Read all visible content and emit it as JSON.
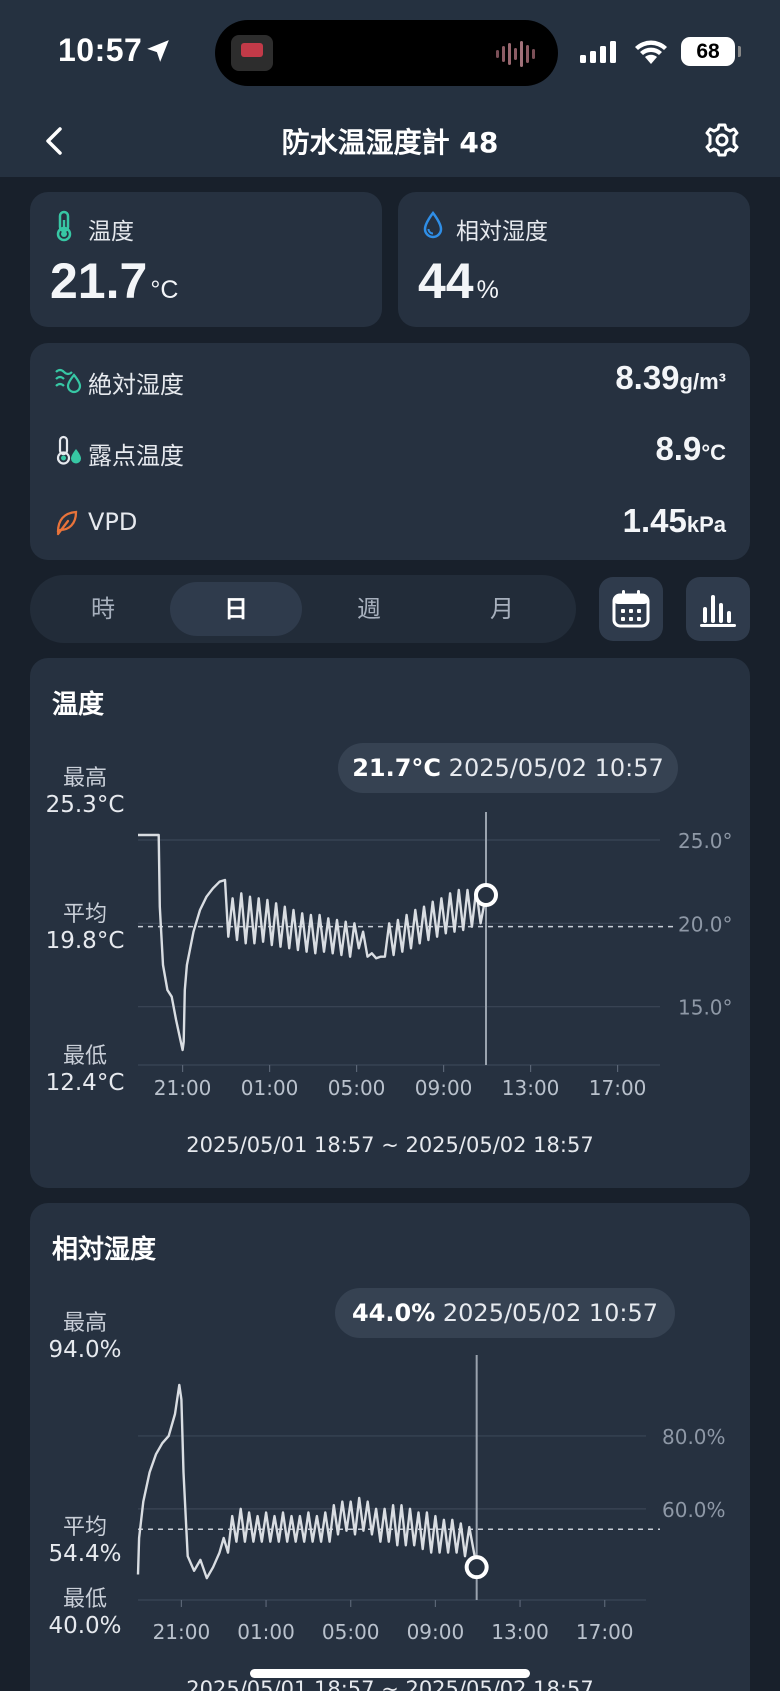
{
  "status": {
    "time": "10:57",
    "battery": "68"
  },
  "header": {
    "title": "防水温湿度計 48"
  },
  "temp_card": {
    "label": "温度",
    "value": "21.7",
    "unit": "°C"
  },
  "humidity_card": {
    "label": "相対湿度",
    "value": "44",
    "unit": "%"
  },
  "metrics": [
    {
      "label": "絶対湿度",
      "value": "8.39",
      "unit": "g/m³",
      "icon": "water-waves-icon"
    },
    {
      "label": "露点温度",
      "value": "8.9",
      "unit": "°C",
      "icon": "dew-thermometer-icon"
    },
    {
      "label": "VPD",
      "value": "1.45",
      "unit": "kPa",
      "icon": "leaf-icon"
    }
  ],
  "tabs": [
    "時",
    "日",
    "週",
    "月"
  ],
  "active_tab": "日",
  "colors": {
    "background": "#18202b",
    "card": "#263140",
    "accent_teal": "#37c7a4",
    "accent_blue": "#2f8ee6",
    "accent_orange": "#e8733a",
    "line": "#d9dde2"
  },
  "chart_data": [
    {
      "type": "line",
      "title": "温度",
      "stats": {
        "max_label": "最高",
        "max_value": "25.3°C",
        "avg_label": "平均",
        "avg_value": "19.8°C",
        "min_label": "最低",
        "min_value": "12.4°C"
      },
      "readout_value": "21.7°C",
      "readout_time": "2025/05/02 10:57",
      "x_ticks": [
        "21:00",
        "01:00",
        "05:00",
        "09:00",
        "13:00",
        "17:00"
      ],
      "y_ticks": [
        "25.0°",
        "20.0°",
        "15.0°"
      ],
      "y_tick_values": [
        25,
        20,
        15
      ],
      "ylim": [
        11.5,
        26.2
      ],
      "xlim": [
        18.95,
        42.95
      ],
      "average": 19.8,
      "cursor_x": 34.95,
      "cursor_y": 21.7,
      "range": "2025/05/01 18:57 ~ 2025/05/02 18:57",
      "x": [
        18.95,
        19.9,
        19.95,
        20.1,
        20.3,
        20.5,
        20.7,
        20.9,
        21.0,
        21.05,
        21.1,
        21.2,
        21.5,
        21.8,
        22.1,
        22.4,
        22.7,
        22.95,
        23.1,
        23.3,
        23.5,
        23.7,
        23.9,
        24.1,
        24.3,
        24.5,
        24.7,
        24.9,
        25.1,
        25.3,
        25.5,
        25.7,
        25.9,
        26.1,
        26.3,
        26.5,
        26.7,
        26.9,
        27.1,
        27.3,
        27.5,
        27.7,
        27.9,
        28.1,
        28.3,
        28.5,
        28.7,
        28.9,
        29.1,
        29.3,
        29.5,
        29.7,
        29.9,
        30.1,
        30.3,
        30.5,
        30.7,
        30.9,
        31.1,
        31.3,
        31.5,
        31.7,
        31.9,
        32.1,
        32.3,
        32.5,
        32.7,
        32.9,
        33.1,
        33.3,
        33.5,
        33.7,
        33.9,
        34.1,
        34.3,
        34.5,
        34.7,
        34.95
      ],
      "y": [
        25.3,
        25.3,
        21.0,
        17.5,
        16.0,
        15.6,
        14.2,
        13.0,
        12.4,
        12.9,
        16.0,
        17.5,
        19.5,
        20.8,
        21.6,
        22.1,
        22.5,
        22.6,
        19.2,
        21.5,
        19.0,
        21.8,
        18.8,
        21.6,
        18.8,
        21.5,
        18.9,
        21.4,
        18.7,
        21.2,
        18.6,
        21.0,
        18.5,
        20.8,
        18.4,
        20.6,
        18.3,
        20.5,
        18.2,
        20.5,
        18.3,
        20.3,
        18.2,
        20.2,
        18.1,
        20.1,
        18.0,
        20.0,
        18.5,
        19.5,
        18.0,
        18.2,
        17.9,
        18.0,
        18.0,
        20.0,
        18.1,
        20.2,
        18.3,
        20.5,
        18.5,
        20.8,
        18.8,
        21.0,
        19.0,
        21.3,
        19.2,
        21.5,
        19.4,
        21.8,
        19.5,
        22.0,
        19.6,
        22.0,
        19.8,
        22.0,
        20.0,
        21.7
      ]
    },
    {
      "type": "line",
      "title": "相対湿度",
      "stats": {
        "max_label": "最高",
        "max_value": "94.0%",
        "avg_label": "平均",
        "avg_value": "54.4%",
        "min_label": "最低",
        "min_value": "40.0%"
      },
      "readout_value": "44.0%",
      "readout_time": "2025/05/02 10:57",
      "x_ticks": [
        "21:00",
        "01:00",
        "05:00",
        "09:00",
        "13:00",
        "17:00"
      ],
      "y_ticks": [
        "80.0%",
        "60.0%"
      ],
      "y_tick_values": [
        80,
        60
      ],
      "ylim": [
        35,
        100
      ],
      "xlim": [
        18.95,
        42.95
      ],
      "average": 54.4,
      "cursor_x": 34.95,
      "cursor_y": 44.0,
      "range": "2025/05/01 18:57 ~ 2025/05/02 18:57",
      "x": [
        18.95,
        19.0,
        19.2,
        19.5,
        19.8,
        20.1,
        20.4,
        20.7,
        20.9,
        21.0,
        21.1,
        21.3,
        21.6,
        21.9,
        22.2,
        22.5,
        22.8,
        23.0,
        23.2,
        23.4,
        23.6,
        23.8,
        24.0,
        24.2,
        24.4,
        24.6,
        24.8,
        25.0,
        25.2,
        25.4,
        25.6,
        25.8,
        26.0,
        26.2,
        26.4,
        26.6,
        26.8,
        27.0,
        27.2,
        27.4,
        27.6,
        27.8,
        28.0,
        28.2,
        28.4,
        28.6,
        28.8,
        29.0,
        29.2,
        29.4,
        29.6,
        29.8,
        30.0,
        30.2,
        30.4,
        30.6,
        30.8,
        31.0,
        31.2,
        31.4,
        31.6,
        31.8,
        32.0,
        32.2,
        32.4,
        32.6,
        32.8,
        33.0,
        33.2,
        33.4,
        33.6,
        33.8,
        34.0,
        34.2,
        34.4,
        34.6,
        34.95
      ],
      "y": [
        42.0,
        52.0,
        62.0,
        70.0,
        75.0,
        78.0,
        80.0,
        86.0,
        94.0,
        90.0,
        70.0,
        47.0,
        43.0,
        46.0,
        41.0,
        44.0,
        48.0,
        52.0,
        48.0,
        58.0,
        51.0,
        60.0,
        51.0,
        59.0,
        51.0,
        58.0,
        51.0,
        59.0,
        51.0,
        58.0,
        51.0,
        59.0,
        51.0,
        58.0,
        51.0,
        58.0,
        51.0,
        59.0,
        51.0,
        58.0,
        51.0,
        59.0,
        51.0,
        61.0,
        53.0,
        62.0,
        54.0,
        62.0,
        53.0,
        63.0,
        54.0,
        62.0,
        53.0,
        60.0,
        51.0,
        60.0,
        51.0,
        61.0,
        50.0,
        61.0,
        50.0,
        60.0,
        50.0,
        59.0,
        49.0,
        59.0,
        48.0,
        58.0,
        48.0,
        57.0,
        48.0,
        57.0,
        48.0,
        56.0,
        47.0,
        55.0,
        44.0
      ]
    }
  ]
}
